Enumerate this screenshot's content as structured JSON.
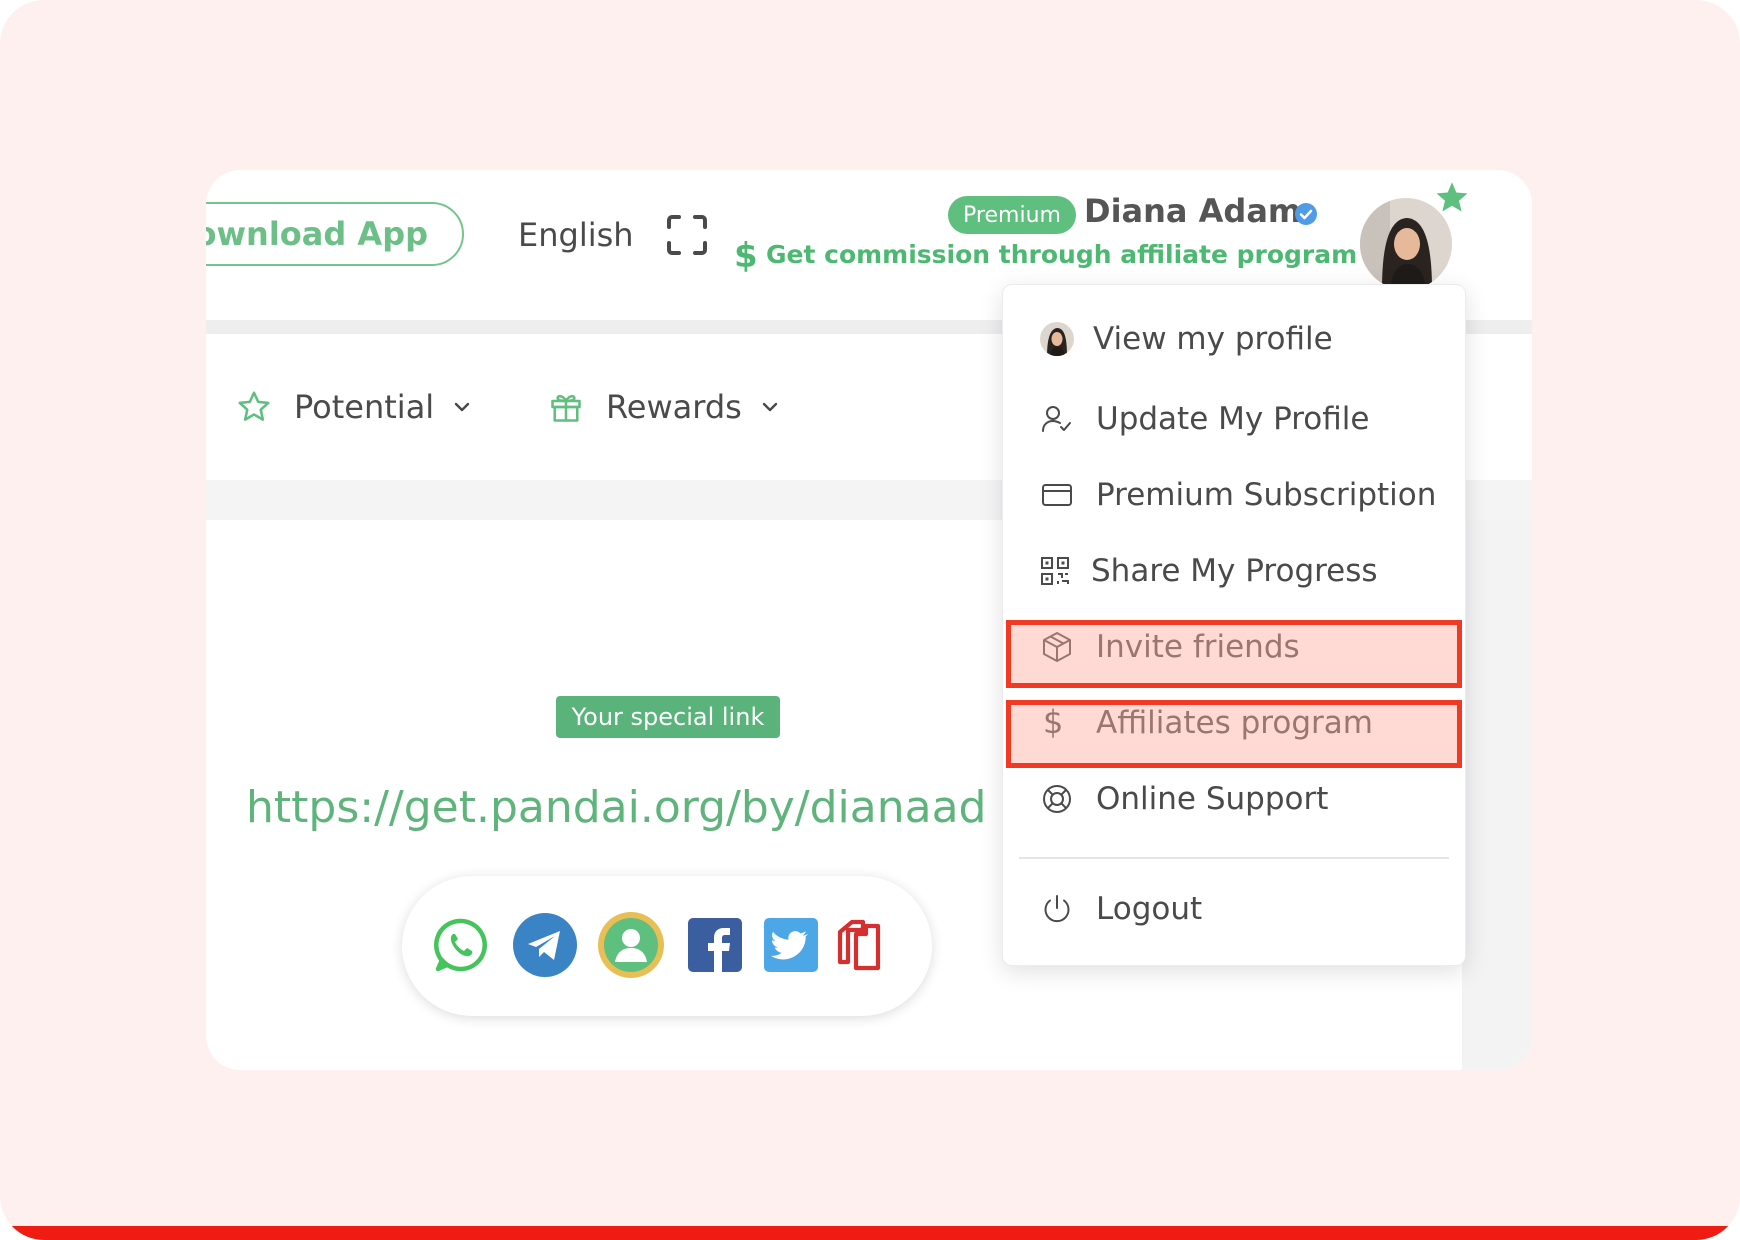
{
  "header": {
    "download_label": "Download App",
    "language": "English",
    "premium_badge": "Premium",
    "user_name": "Diana Adam",
    "commission_icon": "$",
    "commission_text": "Get commission through affiliate program"
  },
  "nav": {
    "items": [
      {
        "label": "Potential",
        "icon": "star-icon"
      },
      {
        "label": "Rewards",
        "icon": "gift-icon"
      }
    ]
  },
  "main": {
    "special_link_label": "Your special link",
    "link": "https://get.pandai.org/by/dianaad",
    "share_icons": [
      "whatsapp-icon",
      "telegram-icon",
      "contact-icon",
      "facebook-icon",
      "twitter-icon",
      "copy-icon"
    ]
  },
  "dropdown": {
    "items": [
      {
        "label": "View my profile",
        "icon": "avatar-icon"
      },
      {
        "label": "Update My Profile",
        "icon": "user-check-icon"
      },
      {
        "label": "Premium Subscription",
        "icon": "credit-card-icon"
      },
      {
        "label": "Share My Progress",
        "icon": "qr-code-icon"
      },
      {
        "label": "Invite friends",
        "icon": "box-icon",
        "highlighted": true
      },
      {
        "label": "Affiliates program",
        "icon": "dollar-icon",
        "dollar_glyph": "$",
        "highlighted": true
      },
      {
        "label": "Online Support",
        "icon": "lifebuoy-icon"
      },
      {
        "label": "Logout",
        "icon": "power-icon"
      }
    ]
  },
  "colors": {
    "brand_green": "#5fbf7e",
    "highlight_border": "#f03a23",
    "frame_bg": "#fdf0ef",
    "bottom_bar": "#ee1c12"
  }
}
